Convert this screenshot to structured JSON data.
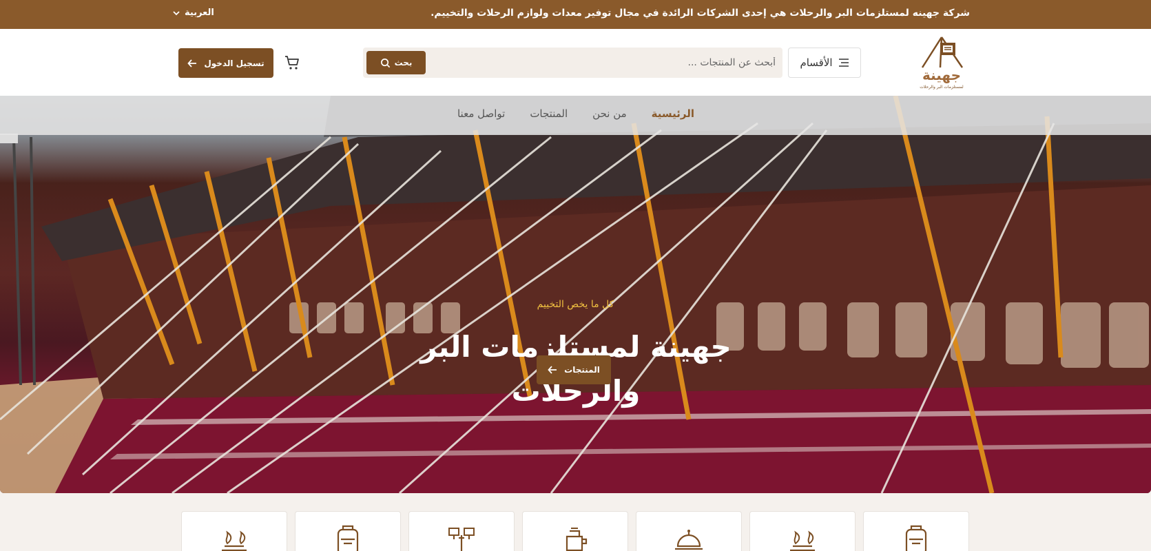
{
  "topbar": {
    "announcement": "شركة جهينه لمستلزمات البر والرحلات هي إحدى الشركات الرائدة في مجال توفير معدات ولوازم الرحلات والتخييم.",
    "language": "العربية"
  },
  "header": {
    "categories_label": "الأقسام",
    "search_placeholder": "أبحث عن المنتجات ...",
    "search_button": "بحث",
    "login_button": "تسجيل الدخول"
  },
  "nav": {
    "items": [
      {
        "label": "الرئيسية",
        "active": true
      },
      {
        "label": "من نحن",
        "active": false
      },
      {
        "label": "المنتجات",
        "active": false
      },
      {
        "label": "تواصل معنا",
        "active": false
      }
    ]
  },
  "hero": {
    "eyebrow": "كل ما يخص التخييم",
    "title": "جهينة لمستلزمات البر والرحلات",
    "cta": "المنتجات"
  },
  "categories": [
    {
      "icon": "backpack-icon"
    },
    {
      "icon": "campfire-icon"
    },
    {
      "icon": "serving-cloche-icon"
    },
    {
      "icon": "kettle-stove-icon"
    },
    {
      "icon": "lantern-lights-icon"
    },
    {
      "icon": "backpack-icon"
    },
    {
      "icon": "campfire-icon"
    }
  ],
  "colors": {
    "brand": "#8a5a2b",
    "button": "#7c4f24",
    "accent_text": "#f0c040"
  }
}
